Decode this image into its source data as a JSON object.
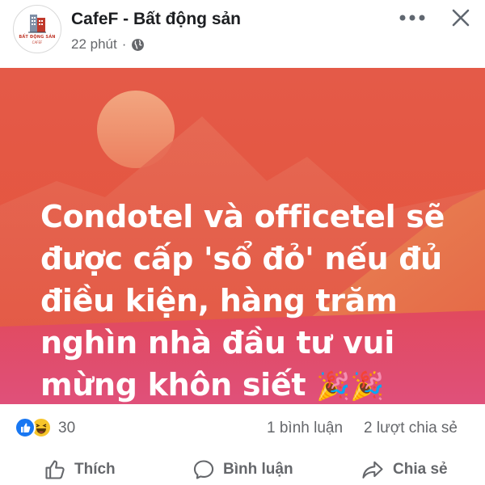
{
  "post": {
    "page_name": "CafeF - Bất động sản",
    "time": "22 phút",
    "privacy_icon": "globe-icon",
    "avatar": {
      "caption": "BẤT ĐỘNG SẢN",
      "sub": "CAFEF"
    }
  },
  "banner": {
    "lines": [
      "Condotel và officetel sẽ",
      "được cấp 'sổ đỏ' nếu đủ",
      "điều kiện, hàng trăm",
      "nghìn nhà đầu tư vui",
      "mừng khôn siết"
    ],
    "emoji": "🎉🎉"
  },
  "stats": {
    "reaction_count": "30",
    "comments": "1 bình luận",
    "shares": "2 lượt chia sẻ"
  },
  "actions": {
    "like": "Thích",
    "comment": "Bình luận",
    "share": "Chia sẻ"
  },
  "colors": {
    "banner_top": "#e45a48",
    "banner_bottom_band": "#e14d6e",
    "like_blue": "#1877f2",
    "haha_yellow": "#f7c52b",
    "meta_gray": "#65676b"
  }
}
